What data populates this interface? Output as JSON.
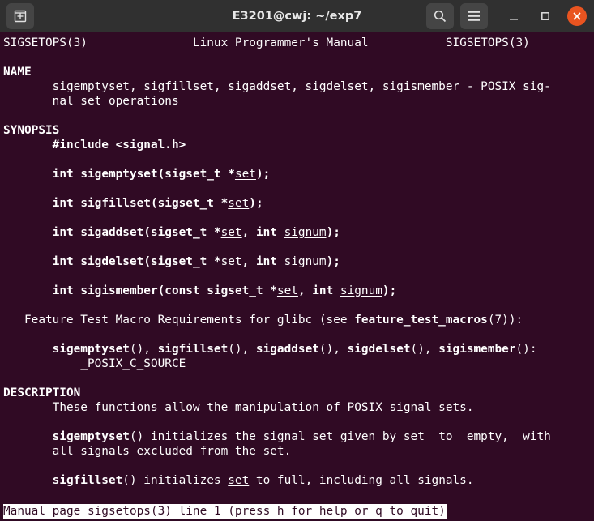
{
  "window": {
    "title": "E3201@cwj: ~/exp7"
  },
  "icons": {
    "new_tab": "new-tab-icon",
    "search": "search-icon",
    "menu": "hamburger-menu-icon",
    "minimize": "minimize-icon",
    "maximize": "maximize-icon",
    "close": "close-icon"
  },
  "colors": {
    "background": "#300a24",
    "titlebar": "#303030",
    "close": "#e95420"
  },
  "man": {
    "header": {
      "left": "SIGSETOPS(3)",
      "center": "Linux Programmer's Manual",
      "right": "SIGSETOPS(3)"
    },
    "name_heading": "NAME",
    "name_line1": "sigemptyset, sigfillset, sigaddset, sigdelset, sigismember - POSIX sig‐",
    "name_line2": "nal set operations",
    "synopsis_heading": "SYNOPSIS",
    "include": "#include <signal.h>",
    "protos": {
      "empty": {
        "ret": "int",
        "name": "sigemptyset",
        "p1": "(sigset_t *",
        "arg1": "set",
        "end": ");"
      },
      "fill": {
        "ret": "int",
        "name": "sigfillset",
        "p1": "(sigset_t *",
        "arg1": "set",
        "end": ");"
      },
      "add": {
        "ret": "int",
        "name": "sigaddset",
        "p1": "(sigset_t *",
        "arg1": "set",
        "mid": ", int ",
        "arg2": "signum",
        "end": ");"
      },
      "del": {
        "ret": "int",
        "name": "sigdelset",
        "p1": "(sigset_t *",
        "arg1": "set",
        "mid": ", int ",
        "arg2": "signum",
        "end": ");"
      },
      "ismember": {
        "ret": "int",
        "name": "sigismember",
        "p1": "(const sigset_t *",
        "arg1": "set",
        "mid": ", int ",
        "arg2": "signum",
        "end": ");"
      }
    },
    "ftm": {
      "pre": "Feature Test Macro Requirements for glibc (see ",
      "link": "feature_test_macros",
      "post": "(7)):"
    },
    "reqs": {
      "f1": "sigemptyset",
      "f2": "sigfillset",
      "f3": "sigaddset",
      "f4": "sigdelset",
      "f5": "sigismember",
      "paren": "()",
      "sep": ", ",
      "end": ":",
      "macro": "_POSIX_C_SOURCE"
    },
    "description_heading": "DESCRIPTION",
    "desc1": "These functions allow the manipulation of POSIX signal sets.",
    "desc2": {
      "fn": "sigemptyset",
      "a": "() initializes the signal set given by ",
      "arg": "set",
      "b": "  to  empty,  with"
    },
    "desc2_line2": "all signals excluded from the set.",
    "desc3": {
      "fn": "sigfillset",
      "a": "() initializes ",
      "arg": "set",
      "b": " to full, including all signals."
    }
  },
  "status_line": "Manual page sigsetops(3) line 1 (press h for help or q to quit)"
}
